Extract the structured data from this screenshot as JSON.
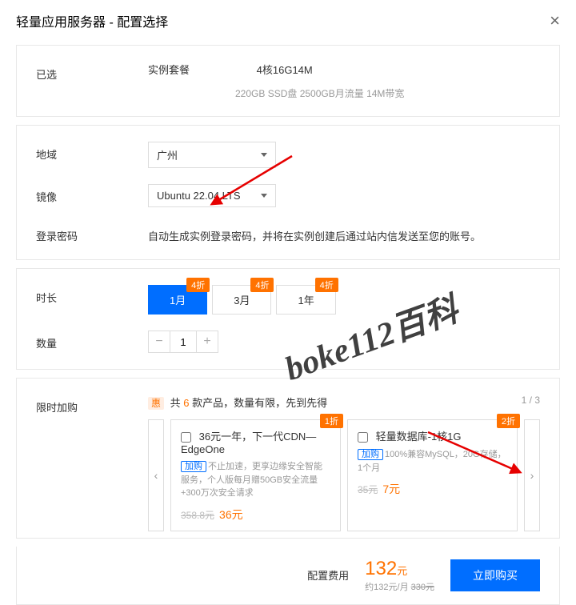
{
  "header": {
    "title": "轻量应用服务器 - 配置选择"
  },
  "selected": {
    "label": "已选",
    "specLabel": "实例套餐",
    "specValue": "4核16G14M",
    "specDetail": "220GB SSD盘 2500GB月流量 14M带宽"
  },
  "region": {
    "label": "地域",
    "value": "广州"
  },
  "image": {
    "label": "镜像",
    "value": "Ubuntu 22.04 LTS"
  },
  "password": {
    "label": "登录密码",
    "text": "自动生成实例登录密码，并将在实例创建后通过站内信发送至您的账号。"
  },
  "duration": {
    "label": "时长",
    "options": [
      {
        "text": "1月",
        "badge": "4折",
        "active": true
      },
      {
        "text": "3月",
        "badge": "4折",
        "active": false
      },
      {
        "text": "1年",
        "badge": "4折",
        "active": false
      }
    ]
  },
  "quantity": {
    "label": "数量",
    "value": "1"
  },
  "addon": {
    "label": "限时加购",
    "hotTag": "惠",
    "hotPrefix": "共 ",
    "hotCount": "6",
    "hotSuffix": " 款产品，数量有限，先到先得",
    "pager": "1 / 3",
    "cards": [
      {
        "badge": "1折",
        "title": "36元一年，下一代CDN—EdgeOne",
        "buyTag": "加购",
        "desc": "不止加速，更享边缘安全智能服务，个人版每月赠50GB安全流量+300万次安全请求",
        "oldPrice": "358.8元",
        "newPrice": "36元"
      },
      {
        "badge": "2折",
        "title": "轻量数据库-1核1G",
        "buyTag": "加购",
        "desc": "100%兼容MySQL，20G存储，1个月",
        "oldPrice": "35元",
        "newPrice": "7元"
      }
    ]
  },
  "footer": {
    "label": "配置费用",
    "price": "132",
    "unit": "元",
    "sub1": "约132元/月",
    "sub2": "330元",
    "buy": "立即购买"
  },
  "watermark": "boke112百科"
}
